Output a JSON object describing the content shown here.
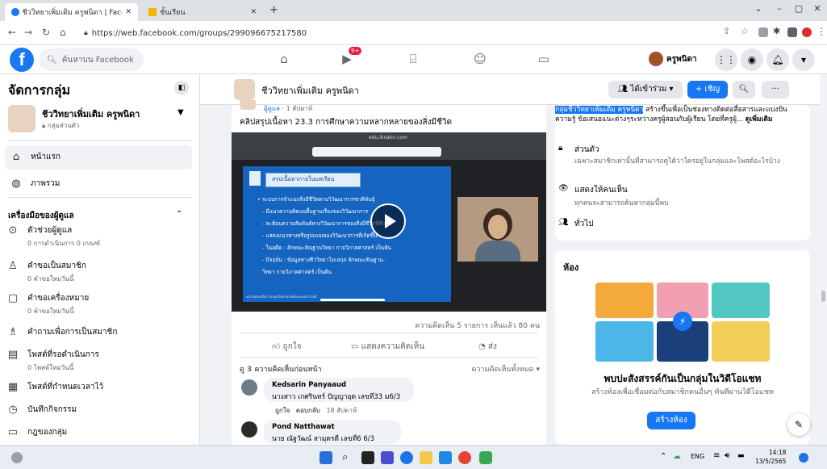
{
  "browser": {
    "tabs": [
      {
        "title": "ชีววิทยาเพิ่มเติม ครูพนิดา | Facebook"
      },
      {
        "title": "ชั้นเรียน"
      }
    ],
    "url": "https://web.facebook.com/groups/299096675217580"
  },
  "fb_header": {
    "search_placeholder": "ค้นหาบน Facebook",
    "notif_badge": "9+",
    "user_name": "ครูพนิดา"
  },
  "sidebar": {
    "heading": "จัดการกลุ่ม",
    "group_name": "ชีววิทยาเพิ่มเติม ครูพนิดา",
    "group_privacy": "กลุ่มส่วนตัว",
    "nav": [
      {
        "label": "หน้าแรก"
      },
      {
        "label": "ภาพรวม"
      }
    ],
    "admin_tools_heading": "เครื่องมือของผู้ดูแล",
    "tools": [
      {
        "label": "ตัวช่วยผู้ดูแล",
        "sub": "0 การดำเนินการ 0 เกณฑ์"
      },
      {
        "label": "คำขอเป็นสมาชิก",
        "sub": "0 คำขอใหม่วันนี้"
      },
      {
        "label": "คำขอเครื่องหมาย",
        "sub": "0 คำขอใหม่วันนี้"
      },
      {
        "label": "คำถามเพื่อการเป็นสมาชิก",
        "sub": ""
      },
      {
        "label": "โพสต์ที่รอดำเนินการ",
        "sub": "0 โพสต์ใหม่วันนี้"
      },
      {
        "label": "โพสต์ที่กำหนดเวลาไว้",
        "sub": ""
      },
      {
        "label": "บันทึกกิจกรรม",
        "sub": ""
      },
      {
        "label": "กฎของกลุ่ม",
        "sub": ""
      }
    ]
  },
  "group_bar": {
    "title": "ชีววิทยาเพิ่มเติม ครูพนิดา",
    "joined_label": "ได้เข้าร่วม",
    "invite_label": "+ เชิญ"
  },
  "post": {
    "author_tag": "ผู้ดูแล",
    "time": "1 สัปดาห์",
    "text": "คลิปสรุปเนื้อหา 23.3 การศึกษาความหลากหลายของสิ่งมีชีวิต",
    "video": {
      "url_text": "edu.iknakn.com",
      "slide_title": "สรุปเนื้อหาภายในบทเรียน",
      "bullets": [
        "• ระบบการจำแนกสิ่งมีชีวิตตามวิวัฒนาการชาติพันธุ์",
        "- มีแนวความคิดบนพื้นฐานเรื่องของวิวัฒนาการ",
        "- สะท้อนความสัมพันธ์ทางวิวัฒนาการของสิ่งมีชีวิตที่ศึกษา",
        "- แสดงแนวทางหรือรูปแบบของวิวัฒนาการที่เกิดขึ้น",
        "- ในอดีต : ลักษณะสัณฐานวิทยา กายวิภาคศาสตร์ เป็นต้น",
        "- ปัจจุบัน : ข้อมูลทางชีววิทยาโมเลกุล ลักษณะสัณฐาน-",
        "  วิทยา กายวิภาคศาสตร์ เป็นต้น"
      ],
      "footer": "สถาบันส่งเสริมการสอนวิทยาศาสตร์และเทคโนโลยี"
    },
    "stats": "ความคิดเห็น 5 รายการ  เห็นแล้ว 80 คน",
    "actions": {
      "like": "ถูกใจ",
      "comment": "แสดงความคิดเห็น",
      "share": "ส่ง"
    },
    "prev_comments": "ดู 3 ความคิดเห็นก่อนหน้า",
    "all_comments": "ความคิดเห็นทั้งหมด",
    "comments": [
      {
        "name": "Kedsarin Panyaaud",
        "text": "นางสาว เกศรินทร์ ปัญญาอุด เลขที่33 ม6/3",
        "like": "ถูกใจ",
        "reply": "ตอบกลับ",
        "time": "18 สัปดาห์"
      },
      {
        "name": "Pond Natthawat",
        "text": "นาย ณัฐวัฒน์ สามุดรดี เลขที่6 6/3",
        "like": "",
        "reply": "",
        "time": ""
      }
    ]
  },
  "about": {
    "highlight": "กลุ่มชีววิทยาเพิ่มเติม ครูพนิดา",
    "desc": " สร้างขึ้นเพื่อเป็นช่องทางติดต่อสื่อสารและแบ่งปันความรู้ ข้อเสนอแนะต่างๆระหว่างครูผู้สอนกับผู้เรียน โดยที่ครูผู้...",
    "more": "ดูเพิ่มเติม",
    "privacy_title": "ส่วนตัว",
    "privacy_desc": "เฉพาะสมาชิกเท่านั้นที่สามารถดูได้ว่าใครอยู่ในกลุ่มและโพสต์อะไรบ้าง",
    "visible_title": "แสดงให้คนเห็น",
    "visible_desc": "ทุกคนจะสามารถค้นหากลุ่มนี้พบ",
    "general": "ทั่วไป"
  },
  "rooms": {
    "heading": "ห้อง",
    "headline": "พบปะสังสรรค์กันเป็นกลุ่มในวิดีโอแชท",
    "desc": "สร้างห้องเพื่อเชื่อมต่อกับสมาชิกคนอื่นๆ ทันทีผ่านวิดีโอแชท",
    "create": "สร้างห้อง"
  },
  "taskbar": {
    "lang": "ENG",
    "time": "14:18",
    "date": "13/5/2565"
  },
  "colors": {
    "fb_blue": "#1877f2",
    "slide_blue": "#1565c0",
    "video_bg": "#202124"
  }
}
